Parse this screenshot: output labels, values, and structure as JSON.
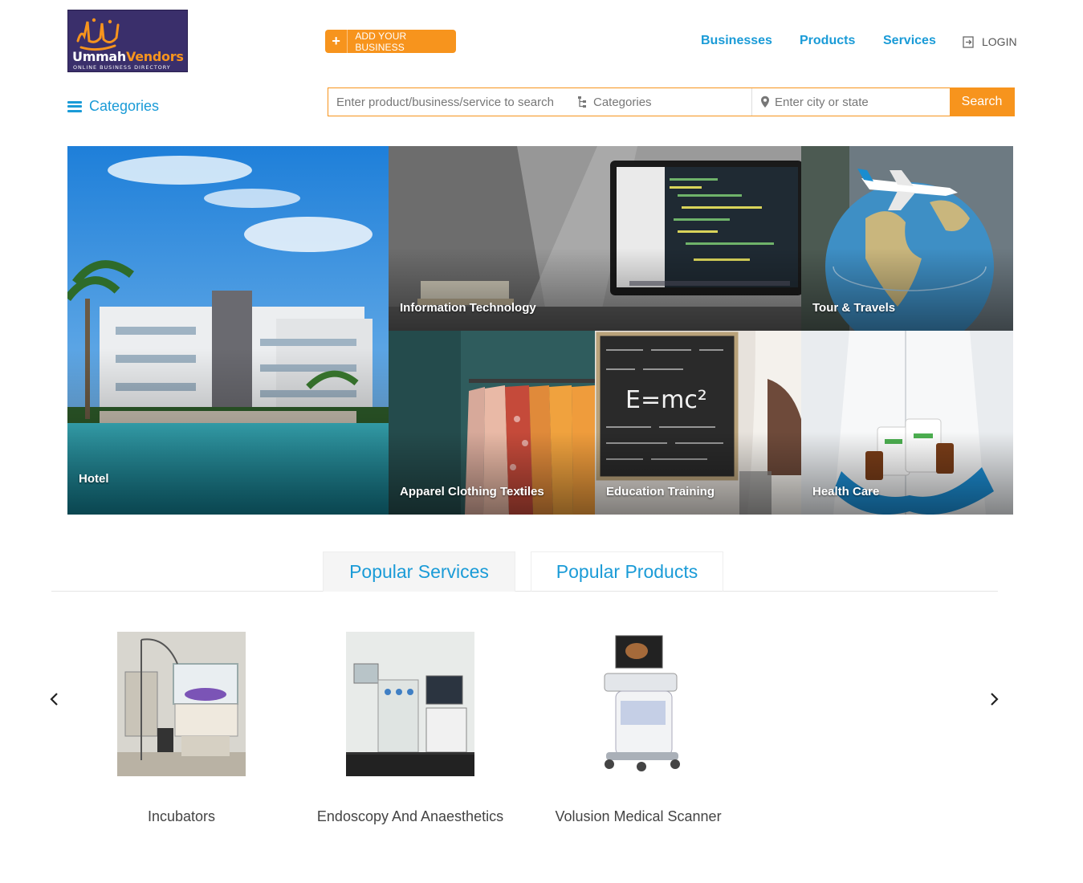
{
  "header": {
    "logo": {
      "brand_part1": "Ummah",
      "brand_part2": "Vendors",
      "tagline": "ONLINE BUSINESS DIRECTORY"
    },
    "add_business_label": "ADD YOUR BUSINESS",
    "nav": {
      "businesses": "Businesses",
      "products": "Products",
      "services": "Services",
      "login": "LOGIN"
    }
  },
  "search": {
    "categories_toggle": "Categories",
    "query_placeholder": "Enter product/business/service to search",
    "category_placeholder": "Categories",
    "location_placeholder": "Enter city or state",
    "button": "Search"
  },
  "categories": [
    {
      "label": "Hotel"
    },
    {
      "label": "Information Technology"
    },
    {
      "label": "Tour & Travels"
    },
    {
      "label": "Apparel Clothing Textiles"
    },
    {
      "label": "Education Training"
    },
    {
      "label": "Health Care"
    }
  ],
  "tabs": [
    {
      "label": "Popular Services",
      "active": true
    },
    {
      "label": "Popular Products",
      "active": false
    }
  ],
  "carousel": {
    "items": [
      {
        "name": "Incubators"
      },
      {
        "name": "Endoscopy And Anaesthetics"
      },
      {
        "name": "Volusion Medical Scanner"
      }
    ]
  },
  "colors": {
    "accent": "#f7941d",
    "link": "#1a9bd7",
    "logo_bg": "#3a2f6b"
  }
}
